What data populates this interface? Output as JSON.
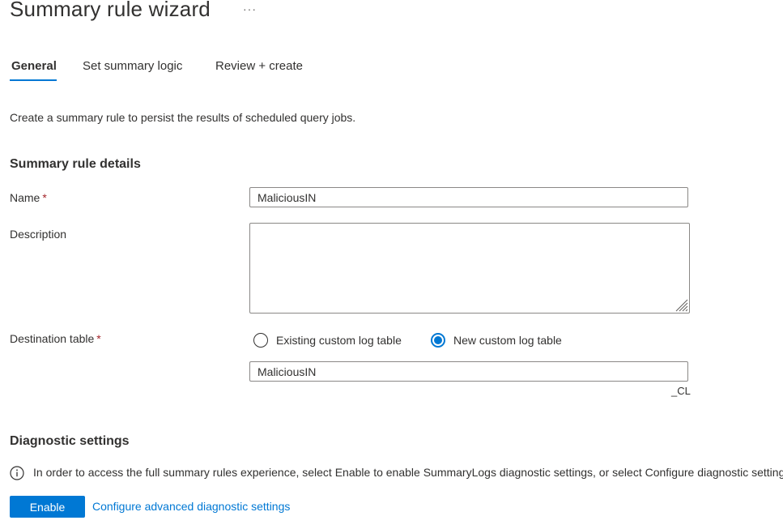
{
  "header": {
    "title": "Summary rule wizard",
    "more_label": "···"
  },
  "tabs": [
    {
      "label": "General",
      "active": true
    },
    {
      "label": "Set summary logic",
      "active": false
    },
    {
      "label": "Review + create",
      "active": false
    }
  ],
  "intro_text": "Create a summary rule to persist the results of scheduled query jobs.",
  "details": {
    "heading": "Summary rule details",
    "name_label": "Name",
    "name_value": "MaliciousIN",
    "required_mark": "*",
    "description_label": "Description",
    "description_value": "",
    "destination_label": "Destination table",
    "radio_existing": "Existing custom log table",
    "radio_new": "New custom log table",
    "selected_option": "New custom log table",
    "table_name_value": "MaliciousIN",
    "table_suffix": "_CL"
  },
  "diagnostics": {
    "heading": "Diagnostic settings",
    "info_text": "In order to access the full summary rules experience, select Enable to enable SummaryLogs diagnostic settings, or select Configure diagnostic settings",
    "enable_label": "Enable",
    "configure_link": "Configure advanced diagnostic settings"
  },
  "colors": {
    "accent": "#0078d4",
    "required": "#a4262c",
    "text": "#323130"
  }
}
